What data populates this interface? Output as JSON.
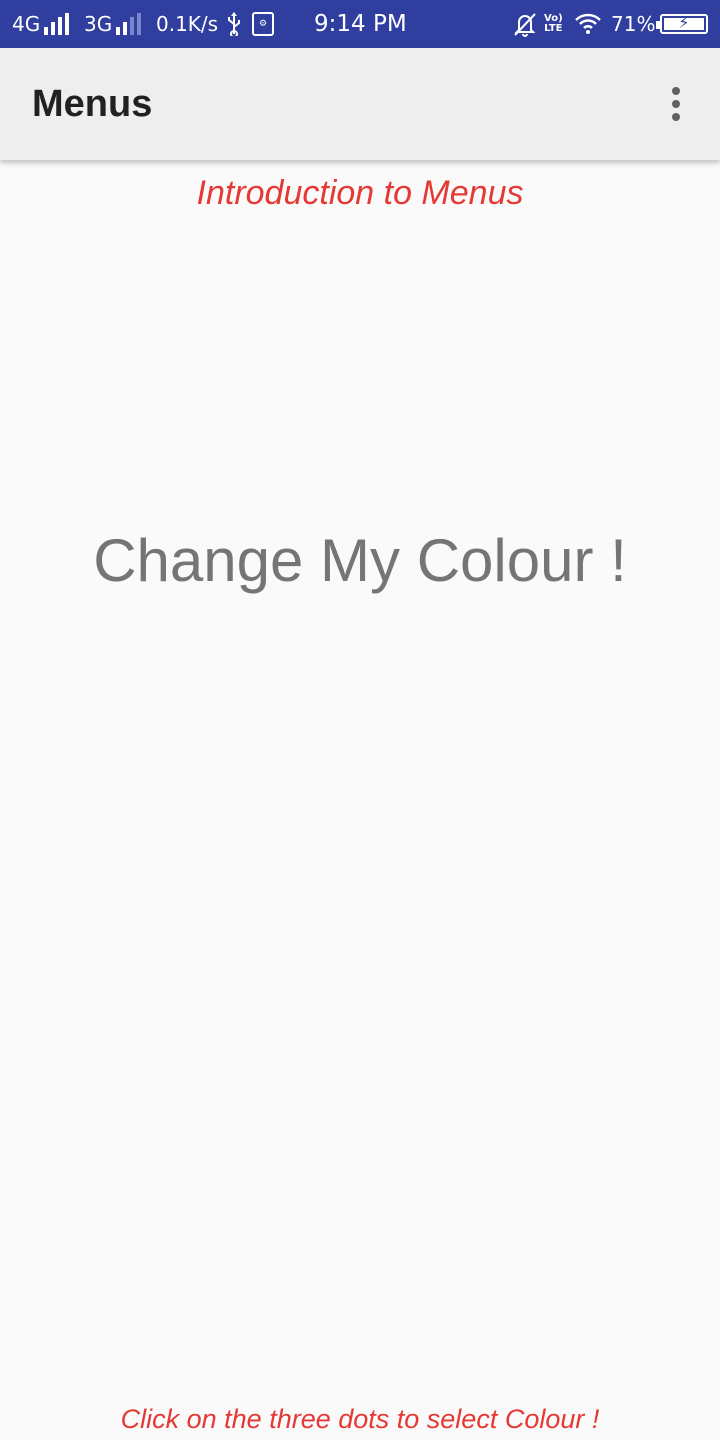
{
  "status_bar": {
    "network1": "4G",
    "network2": "3G",
    "speed": "0.1K/s",
    "time": "9:14 PM",
    "volte_top": "Vo)",
    "volte_bottom": "LTE",
    "battery_percent": "71%",
    "app_icon_text": "⚙",
    "icons": [
      "signal-icon",
      "usb-icon",
      "app-notification-icon",
      "muted-bell-icon",
      "volte-icon",
      "wifi-icon",
      "battery-charging-icon"
    ]
  },
  "app_bar": {
    "title": "Menus",
    "overflow_icon": "more-vertical-icon"
  },
  "main": {
    "intro": "Introduction to Menus",
    "center_text": "Change My Colour !",
    "hint": "Click on the three dots to select Colour !"
  },
  "colors": {
    "status_bar": "#303f9f",
    "app_bar": "#eeeeee",
    "accent_text": "#e53935",
    "center_text": "#757575",
    "background": "#fafafa"
  }
}
